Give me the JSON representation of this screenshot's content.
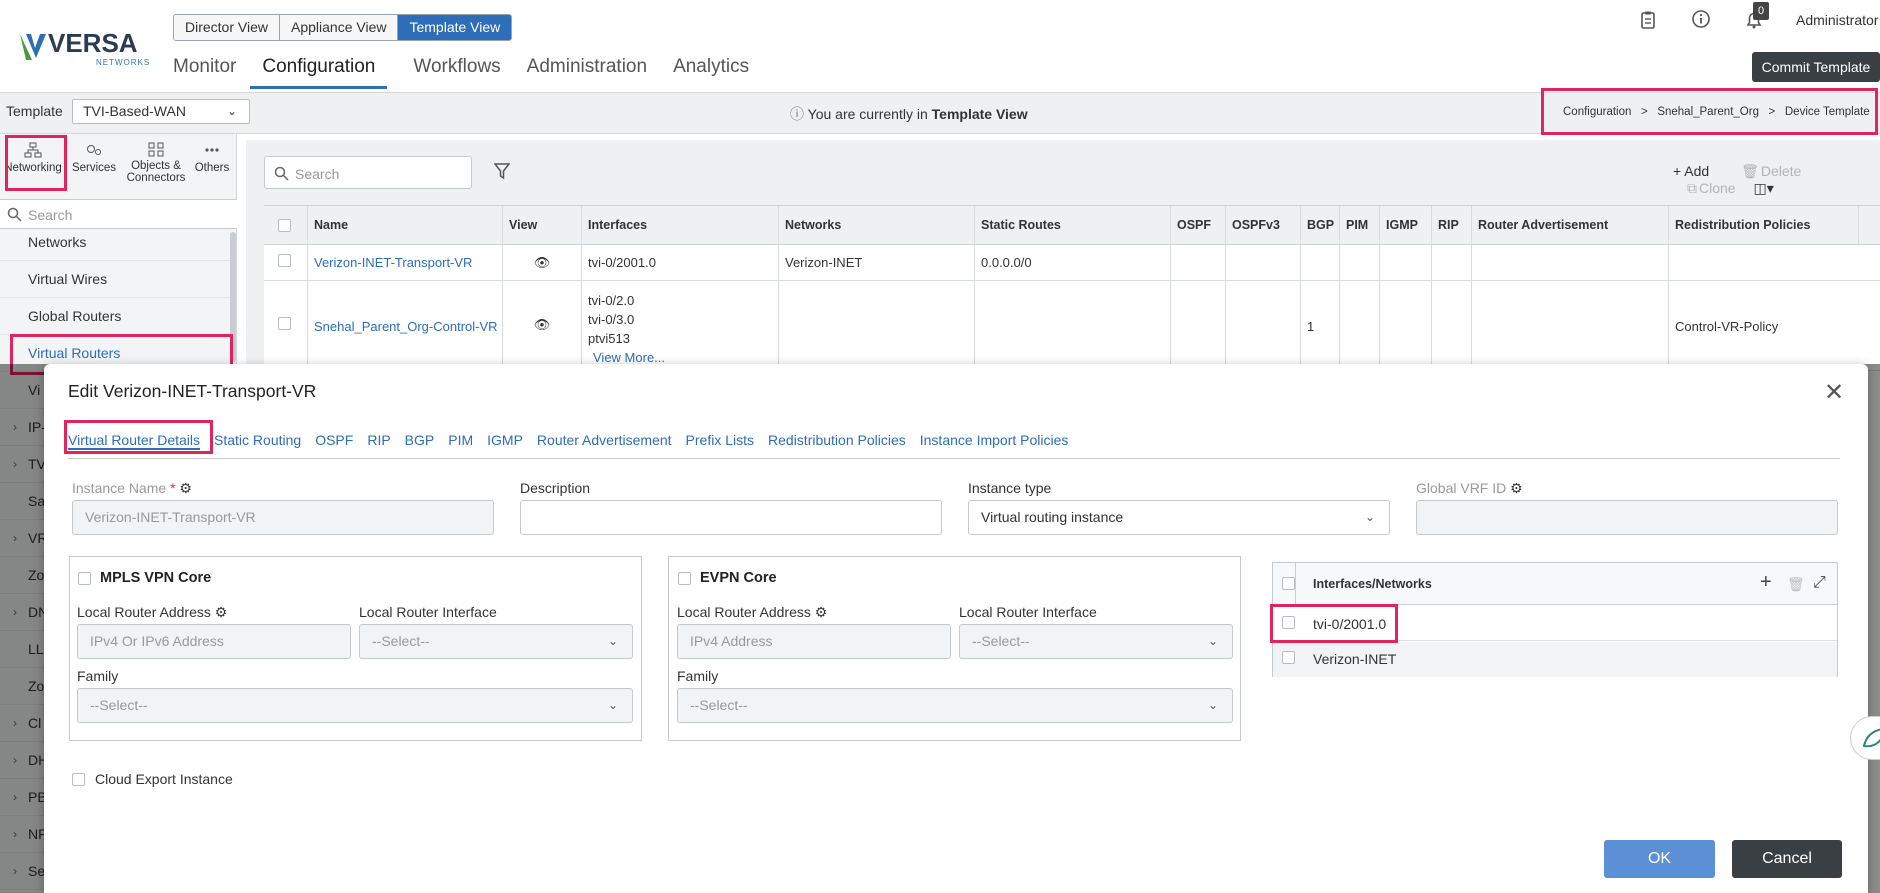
{
  "header": {
    "logo_text": "VERSA",
    "logo_sub": "NETWORKS",
    "view_switch": [
      "Director View",
      "Appliance View",
      "Template View"
    ],
    "main_nav": [
      "Monitor",
      "Configuration",
      "Workflows",
      "Administration",
      "Analytics"
    ],
    "notification_count": "0",
    "user": "Administrator",
    "commit_label": "Commit Template"
  },
  "template_bar": {
    "label": "Template",
    "selected": "TVI-Based-WAN",
    "info_prefix": "You are currently in ",
    "info_bold": "Template View",
    "breadcrumb": [
      "Configuration",
      "Snehal_Parent_Org",
      "Device Template"
    ]
  },
  "left_panel": {
    "tabs": [
      "Networking",
      "Services",
      "Objects & Connectors",
      "Others"
    ],
    "search_placeholder": "Search",
    "items": [
      {
        "label": "Networks",
        "chev": ""
      },
      {
        "label": "Virtual Wires",
        "chev": ""
      },
      {
        "label": "Global Routers",
        "chev": ""
      },
      {
        "label": "Virtual Routers",
        "chev": ""
      },
      {
        "label": "Vi",
        "chev": ""
      },
      {
        "label": "IP-",
        "chev": "›"
      },
      {
        "label": "TV",
        "chev": "›"
      },
      {
        "label": "Sa",
        "chev": ""
      },
      {
        "label": "VR",
        "chev": "›"
      },
      {
        "label": "Zo",
        "chev": ""
      },
      {
        "label": "DN",
        "chev": "›"
      },
      {
        "label": "LL",
        "chev": ""
      },
      {
        "label": "Zo",
        "chev": ""
      },
      {
        "label": "Cl",
        "chev": "›"
      },
      {
        "label": "DH",
        "chev": "›"
      },
      {
        "label": "PB",
        "chev": "›"
      },
      {
        "label": "NF",
        "chev": "›"
      },
      {
        "label": "Se",
        "chev": "›"
      }
    ]
  },
  "grid": {
    "search_placeholder": "Search",
    "actions": {
      "add": "+ Add",
      "delete": "Delete",
      "clone": "Clone"
    },
    "columns": [
      "Name",
      "View",
      "Interfaces",
      "Networks",
      "Static Routes",
      "OSPF",
      "OSPFv3",
      "BGP",
      "PIM",
      "IGMP",
      "RIP",
      "Router Advertisement",
      "Redistribution Policies"
    ],
    "rows": [
      {
        "name": "Verizon-INET-Transport-VR",
        "interfaces": [
          "tvi-0/2001.0"
        ],
        "networks": "Verizon-INET",
        "static_routes": "0.0.0.0/0",
        "bgp": "",
        "redistribution": ""
      },
      {
        "name": "Snehal_Parent_Org-Control-VR",
        "interfaces": [
          "tvi-0/2.0",
          "tvi-0/3.0",
          "ptvi513"
        ],
        "view_more": "View More...",
        "networks": "",
        "static_routes": "",
        "bgp": "1",
        "redistribution": "Control-VR-Policy"
      }
    ]
  },
  "modal": {
    "title": "Edit Verizon-INET-Transport-VR",
    "tabs": [
      "Virtual Router Details",
      "Static Routing",
      "OSPF",
      "RIP",
      "BGP",
      "PIM",
      "IGMP",
      "Router Advertisement",
      "Prefix Lists",
      "Redistribution Policies",
      "Instance Import Policies"
    ],
    "instance_name_label": "Instance Name",
    "instance_name_value": "Verizon-INET-Transport-VR",
    "description_label": "Description",
    "instance_type_label": "Instance type",
    "instance_type_value": "Virtual routing instance",
    "global_vrf_label": "Global VRF ID",
    "mpls": {
      "title": "MPLS VPN Core",
      "local_addr_label": "Local Router Address",
      "local_addr_placeholder": "IPv4 Or IPv6 Address",
      "local_if_label": "Local Router Interface",
      "local_if_value": "--Select--",
      "family_label": "Family",
      "family_value": "--Select--"
    },
    "evpn": {
      "title": "EVPN Core",
      "local_addr_label": "Local Router Address",
      "local_addr_placeholder": "IPv4 Address",
      "local_if_label": "Local Router Interface",
      "local_if_value": "--Select--",
      "family_label": "Family",
      "family_value": "--Select--"
    },
    "interfaces_networks": {
      "header": "Interfaces/Networks",
      "rows": [
        "tvi-0/2001.0",
        "Verizon-INET"
      ]
    },
    "cloud_export_label": "Cloud Export Instance",
    "ok_label": "OK",
    "cancel_label": "Cancel"
  },
  "colors": {
    "accent": "#2e6db8",
    "highlight": "#e0245e",
    "ok_button": "#5b8fd6",
    "cancel_button": "#3a3f44"
  }
}
